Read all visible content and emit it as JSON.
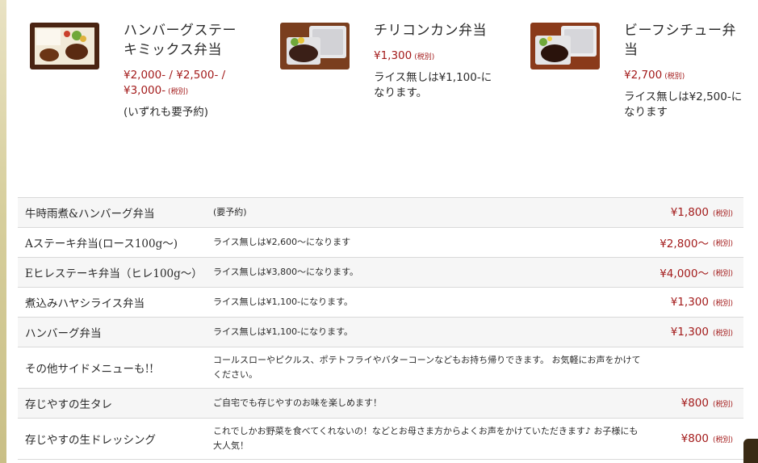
{
  "featured": [
    {
      "title": "ハンバーグステーキミックス弁当",
      "price": "¥2,000- / ¥2,500- / ¥3,000-",
      "tax": "(税別)",
      "note": "(いずれも要予約)",
      "image_icon": "bento-hamburg-image"
    },
    {
      "title": "チリコンカン弁当",
      "price": "¥1,300",
      "tax": "(税別)",
      "note": "ライス無しは¥1,100-になります。",
      "image_icon": "bento-chili-image"
    },
    {
      "title": "ビーフシチュー弁当",
      "price": "¥2,700",
      "tax": "(税別)",
      "note": "ライス無しは¥2,500-になります",
      "image_icon": "bento-stew-image"
    }
  ],
  "menu": [
    {
      "name": "牛時雨煮&ハンバーグ弁当",
      "desc": "(要予約)",
      "price": "¥1,800",
      "tax": "(税別)"
    },
    {
      "name": "Aステーキ弁当(ロース100g〜)",
      "desc": "ライス無しは¥2,600〜になります",
      "price": "¥2,800〜",
      "tax": "(税別)"
    },
    {
      "name": "Eヒレステーキ弁当（ヒレ100g〜）",
      "desc": "ライス無しは¥3,800〜になります。",
      "price": "¥4,000〜",
      "tax": "(税別)"
    },
    {
      "name": "煮込みハヤシライス弁当",
      "desc": "ライス無しは¥1,100-になります。",
      "price": "¥1,300",
      "tax": "(税別)"
    },
    {
      "name": "ハンバーグ弁当",
      "desc": "ライス無しは¥1,100-になります。",
      "price": "¥1,300",
      "tax": "(税別)"
    },
    {
      "name": "その他サイドメニューも!!",
      "desc": "コールスローやピクルス、ポテトフライやバターコーンなどもお持ち帰りできます。 お気軽にお声をかけてください。",
      "price": "",
      "tax": ""
    },
    {
      "name": "存じやすの生タレ",
      "desc": "ご自宅でも存じやすのお味を楽しめます！",
      "price": "¥800",
      "tax": "(税別)"
    },
    {
      "name": "存じやすの生ドレッシング",
      "desc": "これでしかお野菜を食べてくれないの！などとお母さま方からよくお声をかけていただきます♪ お子様にも大人気！",
      "price": "¥800",
      "tax": "(税別)"
    }
  ],
  "colors": {
    "price": "#a31b1b",
    "row_alt": "#f6f6f6",
    "border": "#d9d9d9"
  }
}
